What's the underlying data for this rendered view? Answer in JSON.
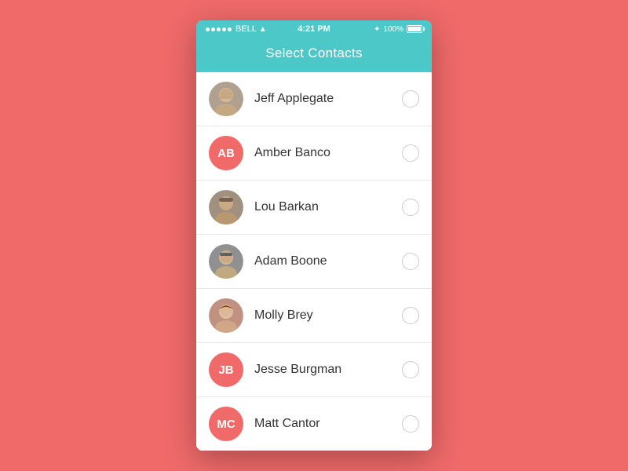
{
  "statusBar": {
    "carrier": "BELL",
    "time": "4:21 PM",
    "battery": "100%"
  },
  "header": {
    "title": "Select Contacts"
  },
  "contacts": [
    {
      "id": "jeff-applegate",
      "name": "Jeff Applegate",
      "initials": null,
      "avatarType": "photo",
      "photoColor": "#8a8a8a"
    },
    {
      "id": "amber-banco",
      "name": "Amber Banco",
      "initials": "AB",
      "avatarType": "initials",
      "bgColor": "#F06A6A"
    },
    {
      "id": "lou-barkan",
      "name": "Lou Barkan",
      "initials": null,
      "avatarType": "photo",
      "photoColor": "#7a7a7a"
    },
    {
      "id": "adam-boone",
      "name": "Adam Boone",
      "initials": null,
      "avatarType": "photo",
      "photoColor": "#9a9a9a"
    },
    {
      "id": "molly-brey",
      "name": "Molly Brey",
      "initials": null,
      "avatarType": "photo",
      "photoColor": "#8a6a6a"
    },
    {
      "id": "jesse-burgman",
      "name": "Jesse Burgman",
      "initials": "JB",
      "avatarType": "initials",
      "bgColor": "#F06A6A"
    },
    {
      "id": "matt-cantor",
      "name": "Matt Cantor",
      "initials": "MC",
      "avatarType": "initials",
      "bgColor": "#F06A6A"
    }
  ],
  "colors": {
    "background": "#F06A6A",
    "headerBg": "#4DC8C8",
    "headerText": "#ffffff"
  }
}
